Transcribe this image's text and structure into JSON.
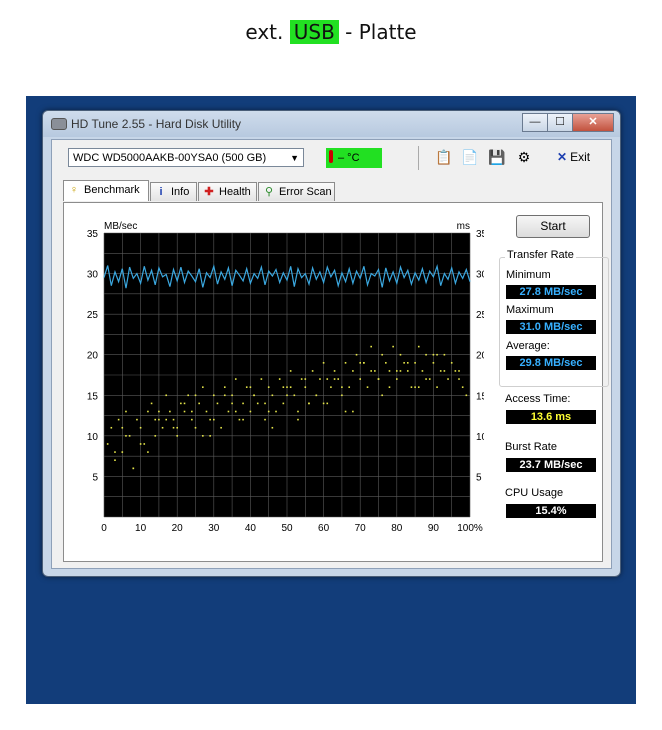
{
  "caption": {
    "before": "ext.",
    "highlight": "USB",
    "after": "- Platte"
  },
  "window": {
    "title": "HD Tune 2.55 - Hard Disk Utility",
    "min_label": "—",
    "max_label": "☐",
    "close_label": "✕"
  },
  "toolbar": {
    "drive": "WDC WD5000AAKB-00YSA0 (500 GB)",
    "temperature": "– °C",
    "exit_label": "Exit",
    "icons": [
      "copy-icon",
      "copy-info-icon",
      "save-icon",
      "options-icon"
    ]
  },
  "tabs": [
    {
      "label": "Benchmark",
      "icon": "bulb-icon"
    },
    {
      "label": "Info",
      "icon": "info-icon"
    },
    {
      "label": "Health",
      "icon": "health-cross-icon"
    },
    {
      "label": "Error Scan",
      "icon": "magnifier-icon"
    }
  ],
  "benchmark": {
    "start_label": "Start",
    "transfer_rate_title": "Transfer Rate",
    "minimum_label": "Minimum",
    "minimum_value": "27.8 MB/sec",
    "maximum_label": "Maximum",
    "maximum_value": "31.0 MB/sec",
    "average_label": "Average:",
    "average_value": "29.8 MB/sec",
    "access_time_label": "Access Time:",
    "access_time_value": "13.6 ms",
    "burst_rate_label": "Burst Rate",
    "burst_rate_value": "23.7 MB/sec",
    "cpu_usage_label": "CPU Usage",
    "cpu_usage_value": "15.4%"
  },
  "colors": {
    "transfer_line": "#3ba8e0",
    "access_points": "#e6e64a",
    "plot_bg": "#000000",
    "grid": "#5a5a5a",
    "desktop": "#123d7a",
    "highlight": "#22e022"
  },
  "chart_data": {
    "type": "line",
    "left_unit": "MB/sec",
    "right_unit": "ms",
    "ylim": [
      0,
      35
    ],
    "xlim": [
      0,
      100
    ],
    "y_ticks": [
      5,
      10,
      15,
      20,
      25,
      30,
      35
    ],
    "x_ticks": [
      "0",
      "10",
      "20",
      "30",
      "40",
      "50",
      "60",
      "70",
      "80",
      "90",
      "100%"
    ],
    "grid": true,
    "series": [
      {
        "type": "line",
        "values": [
          29.5,
          31.0,
          28.5,
          30.2,
          29.0,
          30.6,
          28.2,
          30.8,
          29.4,
          30.0,
          28.8,
          30.9,
          29.2,
          30.4,
          28.6,
          30.7,
          29.6,
          29.9,
          28.4,
          30.5,
          29.1,
          30.8,
          28.9,
          30.3,
          29.7,
          29.0,
          30.6,
          28.3,
          30.1,
          29.5,
          30.9,
          28.7,
          30.2,
          29.3,
          30.7,
          28.5,
          30.4,
          29.8,
          29.1,
          30.6,
          28.8,
          30.0,
          29.4,
          30.8,
          28.6,
          30.3,
          29.7,
          30.5,
          28.9,
          30.1,
          29.2,
          30.9,
          28.4,
          30.6,
          29.5,
          30.0,
          28.7,
          30.7,
          29.3,
          30.2,
          28.9,
          30.8,
          29.6,
          30.4,
          28.5,
          30.1,
          29.0,
          30.6,
          28.8,
          30.3,
          29.4,
          30.9,
          28.6,
          30.0,
          29.7,
          30.5,
          28.3,
          30.7,
          29.1,
          30.2,
          28.8,
          30.8,
          29.5,
          30.4,
          28.7,
          30.1,
          29.2,
          30.6,
          28.9,
          30.3,
          29.6,
          30.9,
          28.5,
          30.0,
          29.3,
          30.7,
          28.8,
          30.2,
          29.4,
          30.5,
          29.0
        ]
      },
      {
        "type": "scatter",
        "x": [
          1,
          2,
          3,
          4,
          5,
          6,
          7,
          8,
          9,
          10,
          11,
          12,
          13,
          14,
          15,
          16,
          17,
          18,
          19,
          20,
          21,
          22,
          23,
          24,
          25,
          26,
          27,
          28,
          29,
          30,
          31,
          32,
          33,
          34,
          35,
          36,
          37,
          38,
          39,
          40,
          41,
          42,
          43,
          44,
          45,
          46,
          47,
          48,
          49,
          50,
          51,
          52,
          53,
          54,
          55,
          56,
          57,
          58,
          59,
          60,
          61,
          62,
          63,
          64,
          65,
          66,
          67,
          68,
          69,
          70,
          71,
          72,
          73,
          74,
          75,
          76,
          77,
          78,
          79,
          80,
          81,
          82,
          83,
          84,
          85,
          86,
          87,
          88,
          89,
          90,
          91,
          92,
          93,
          94,
          95,
          96,
          97,
          98,
          99,
          3,
          8,
          14,
          19,
          24,
          29,
          33,
          38,
          44,
          49,
          53,
          58,
          63,
          68,
          73,
          78,
          83,
          88,
          93,
          97,
          6,
          12,
          17,
          22,
          27,
          36,
          41,
          46,
          51,
          56,
          61,
          66,
          71,
          76,
          81,
          86,
          91,
          5,
          10,
          15,
          20,
          25,
          30,
          35,
          40,
          45,
          50,
          55,
          60,
          65,
          70,
          75,
          80,
          85,
          90
        ],
        "y": [
          9,
          11,
          7,
          12,
          8,
          13,
          10,
          6,
          12,
          11,
          9,
          13,
          14,
          10,
          12,
          11,
          15,
          13,
          12,
          10,
          14,
          13,
          15,
          12,
          11,
          14,
          16,
          13,
          12,
          15,
          14,
          11,
          16,
          13,
          15,
          17,
          12,
          14,
          16,
          13,
          15,
          14,
          17,
          12,
          16,
          15,
          13,
          17,
          14,
          16,
          18,
          15,
          13,
          17,
          16,
          14,
          18,
          15,
          17,
          19,
          14,
          16,
          18,
          17,
          15,
          19,
          16,
          18,
          20,
          17,
          19,
          16,
          21,
          18,
          17,
          20,
          19,
          18,
          21,
          17,
          20,
          19,
          18,
          16,
          19,
          21,
          18,
          20,
          17,
          19,
          16,
          18,
          20,
          17,
          19,
          18,
          17,
          16,
          15,
          8,
          6,
          12,
          11,
          13,
          10,
          15,
          12,
          14,
          16,
          12,
          15,
          17,
          13,
          18,
          16,
          19,
          17,
          18,
          18,
          10,
          8,
          12,
          14,
          10,
          13,
          15,
          11,
          16,
          14,
          17,
          13,
          19,
          15,
          18,
          16,
          20,
          11,
          9,
          13,
          11,
          15,
          12,
          14,
          16,
          13,
          15,
          17,
          14,
          16,
          19,
          17,
          18,
          16,
          20
        ]
      }
    ]
  }
}
